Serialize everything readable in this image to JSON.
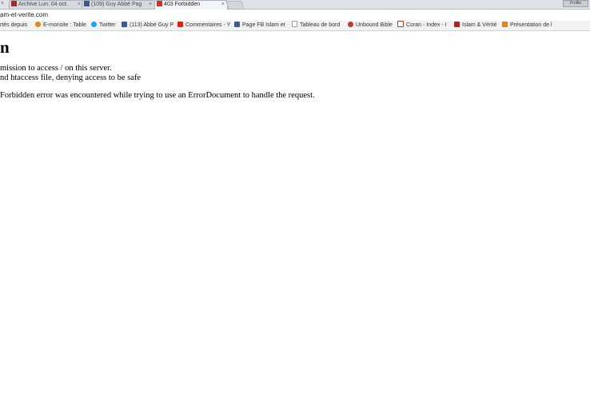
{
  "tabs": [
    {
      "title": "Archive Lun. 04 oct.",
      "close": "×",
      "active": false
    },
    {
      "title": "(109) Guy Abbé Pag",
      "close": "×",
      "active": false
    },
    {
      "title": "403 Forbidden",
      "close": "×",
      "active": true
    }
  ],
  "profile_label": "Profile",
  "address_bar": {
    "url": "am-et-verite.com"
  },
  "bookmarks": [
    {
      "label": "rtés depuis",
      "icon": "bookmark-icon",
      "color": "#888888"
    },
    {
      "label": "E-monsite : Table",
      "icon": "emonsite-icon",
      "color": "#e08a1e"
    },
    {
      "label": "Twitter",
      "icon": "twitter-icon",
      "color": "#1da1f2"
    },
    {
      "label": "(113) Abbé Guy P",
      "icon": "facebook-icon",
      "color": "#3b5998"
    },
    {
      "label": "Commentaires - Y",
      "icon": "youtube-icon",
      "color": "#e62117"
    },
    {
      "label": "Page FB Islam et",
      "icon": "facebook-icon",
      "color": "#3b5998"
    },
    {
      "label": "Tableau de bord",
      "icon": "page-icon",
      "color": "#9aa0a6"
    },
    {
      "label": "Unbound Bible",
      "icon": "unbound-icon",
      "color": "#c0392b"
    },
    {
      "label": "Coran - Index - I",
      "icon": "coran-icon",
      "color": "#c0392b"
    },
    {
      "label": "Islam & Vérité",
      "icon": "islam-verite-icon",
      "color": "#b22222"
    },
    {
      "label": "Présentation de l",
      "icon": "presentation-icon",
      "color": "#e67e22"
    }
  ],
  "page": {
    "heading": "n",
    "message_line1": "mission to access / on this server.",
    "message_line2": "nd htaccess file, denying access to be safe",
    "message_line3": "Forbidden error was encountered while trying to use an ErrorDocument to handle the request."
  }
}
